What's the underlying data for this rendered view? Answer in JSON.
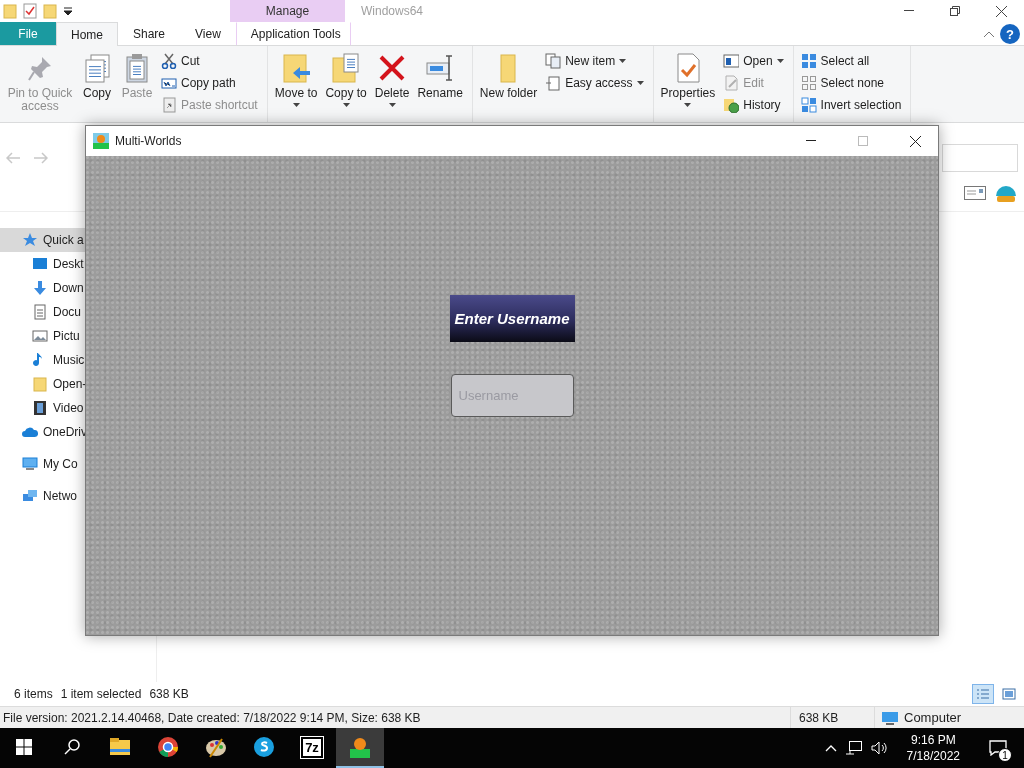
{
  "explorer": {
    "context_header": "Manage",
    "title": "Windows64",
    "tabs": [
      {
        "label": "File",
        "kind": "file",
        "selected": false
      },
      {
        "label": "Home",
        "kind": "plain",
        "selected": true
      },
      {
        "label": "Share",
        "kind": "plain",
        "selected": false
      },
      {
        "label": "View",
        "kind": "plain",
        "selected": false
      },
      {
        "label": "Application Tools",
        "kind": "context",
        "selected": false
      }
    ],
    "help": "?",
    "ribbon": [
      [
        {
          "kind": "large",
          "label": "Pin to Quick access",
          "disabled": true,
          "dropdown": false
        },
        {
          "kind": "large",
          "label": "Copy",
          "disabled": false,
          "dropdown": false
        },
        {
          "kind": "large",
          "label": "Paste",
          "disabled": true,
          "dropdown": false
        },
        {
          "kind": "stack",
          "items": [
            {
              "label": "Cut",
              "disabled": false,
              "dropdown": false
            },
            {
              "label": "Copy path",
              "disabled": false,
              "dropdown": false
            },
            {
              "label": "Paste shortcut",
              "disabled": true,
              "dropdown": false
            }
          ]
        }
      ],
      [
        {
          "kind": "large",
          "label": "Move to",
          "disabled": false,
          "dropdown": true
        },
        {
          "kind": "large",
          "label": "Copy to",
          "disabled": false,
          "dropdown": true
        },
        {
          "kind": "large",
          "label": "Delete",
          "disabled": false,
          "dropdown": true
        },
        {
          "kind": "large",
          "label": "Rename",
          "disabled": false,
          "dropdown": false
        }
      ],
      [
        {
          "kind": "large",
          "label": "New folder",
          "disabled": false,
          "dropdown": false
        },
        {
          "kind": "stack",
          "items": [
            {
              "label": "New item",
              "disabled": false,
              "dropdown": true
            },
            {
              "label": "Easy access",
              "disabled": false,
              "dropdown": true
            }
          ]
        }
      ],
      [
        {
          "kind": "large",
          "label": "Properties",
          "disabled": false,
          "dropdown": true
        },
        {
          "kind": "stack",
          "items": [
            {
              "label": "Open",
              "disabled": false,
              "dropdown": true
            },
            {
              "label": "Edit",
              "disabled": true,
              "dropdown": false
            },
            {
              "label": "History",
              "disabled": false,
              "dropdown": false
            }
          ]
        }
      ],
      [
        {
          "kind": "stack",
          "items": [
            {
              "label": "Select all",
              "disabled": false,
              "dropdown": false
            },
            {
              "label": "Select none",
              "disabled": false,
              "dropdown": false
            },
            {
              "label": "Invert selection",
              "disabled": false,
              "dropdown": false
            }
          ]
        }
      ]
    ],
    "navigation": [
      {
        "label": "Quick a",
        "selected": true,
        "children": [
          {
            "label": "Deskt",
            "selected": false
          },
          {
            "label": "Down",
            "selected": false
          },
          {
            "label": "Docu",
            "selected": false
          },
          {
            "label": "Pictu",
            "selected": false
          },
          {
            "label": "Music",
            "selected": false
          },
          {
            "label": "Open-",
            "selected": false
          },
          {
            "label": "Video",
            "selected": false
          }
        ]
      },
      {
        "label": "OneDriv",
        "selected": false
      },
      {
        "label": "My Co",
        "selected": false
      },
      {
        "label": "Netwo",
        "selected": false
      }
    ],
    "status_bar": {
      "item_count": "6 items",
      "selection": "1 item selected",
      "selection_size": "638 KB",
      "views": [
        {
          "selected": true
        },
        {
          "selected": false
        }
      ]
    },
    "details_bar": {
      "info": "File version: 2021.2.14.40468, Date created: 7/18/2022 9:14 PM, Size: 638 KB",
      "size": "638 KB",
      "location": "Computer"
    }
  },
  "dialog": {
    "title": "Multi-Worlds",
    "heading": "Enter Username",
    "username": {
      "placeholder": "Username"
    }
  },
  "taskbar": {
    "apps": [
      {
        "selected": false
      },
      {
        "selected": false
      },
      {
        "selected": false
      },
      {
        "selected": false
      },
      {
        "selected": false,
        "icon_text": "7z"
      },
      {
        "selected": true
      }
    ],
    "time": "9:16 PM",
    "date": "7/18/2022",
    "notification_count": "1"
  }
}
